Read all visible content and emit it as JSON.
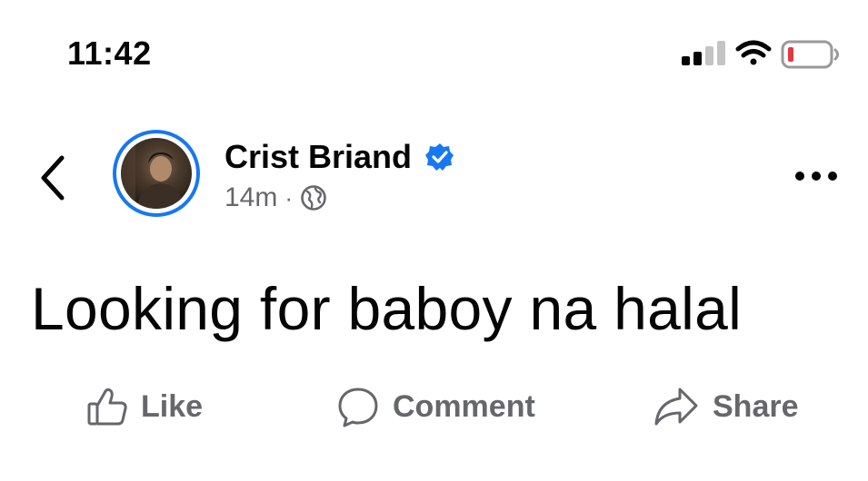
{
  "status_bar": {
    "time": "11:42",
    "icons": [
      "cellular-signal-icon",
      "wifi-icon",
      "battery-low-icon"
    ],
    "battery_color": "#e0393e"
  },
  "header": {
    "back_icon": "chevron-left-icon",
    "author": "Crist Briand",
    "verified_icon": "verified-badge-icon",
    "verified_color": "#1877f2",
    "time_ago": "14m",
    "separator": "·",
    "audience_icon": "globe-icon",
    "more_icon": "more-options-icon"
  },
  "post": {
    "text": "Looking for baboy na halal"
  },
  "actions": {
    "like": "Like",
    "comment": "Comment",
    "share": "Share"
  },
  "colors": {
    "brand": "#1877f2",
    "secondary_text": "#65676b"
  }
}
